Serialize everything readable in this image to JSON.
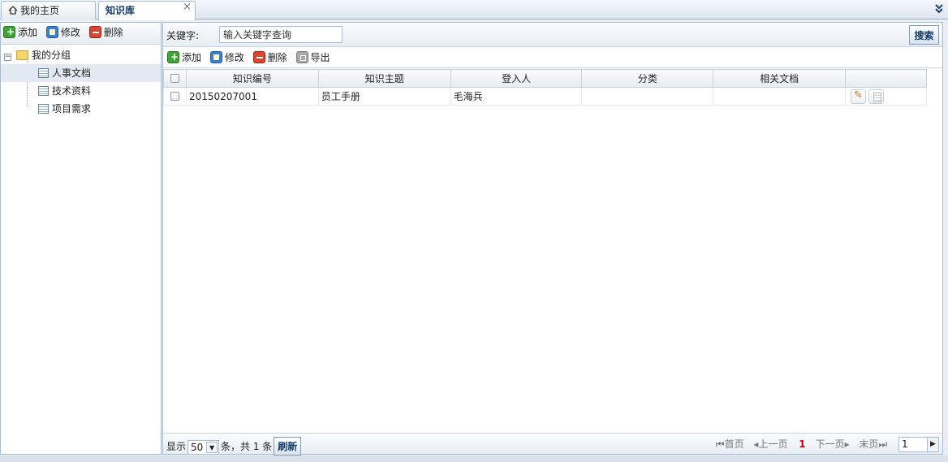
{
  "tabs": [
    {
      "label": "我的主页",
      "icon": "home-icon",
      "active": false
    },
    {
      "label": "知识库",
      "active": true,
      "close": "×"
    }
  ],
  "left_toolbar": {
    "add": "添加",
    "edit": "修改",
    "delete": "删除"
  },
  "tree": {
    "root": {
      "toggle": "⊟",
      "label": "我的分组"
    },
    "children": [
      "人事文档",
      "技术资料",
      "项目需求"
    ]
  },
  "search": {
    "label": "关键字:",
    "value": "输入关键字查询",
    "button": "搜索"
  },
  "grid_toolbar": {
    "add": "添加",
    "edit": "修改",
    "delete": "删除",
    "export": "导出"
  },
  "grid": {
    "columns": [
      "知识编号",
      "知识主题",
      "登入人",
      "分类",
      "相关文档"
    ],
    "rows": [
      {
        "id": "20150207001",
        "subject": "员工手册",
        "user": "毛海兵",
        "category": "",
        "docs": ""
      }
    ]
  },
  "pager": {
    "show": "显示",
    "page_size": "50",
    "summary": "条，共 1 条",
    "refresh": "刷新",
    "first": "首页",
    "prev": "上一页",
    "current": "1",
    "next": "下一页",
    "last": "末页",
    "page_input": "1"
  },
  "colors": {
    "accent": "#123a6b",
    "current_page": "#d00000"
  }
}
